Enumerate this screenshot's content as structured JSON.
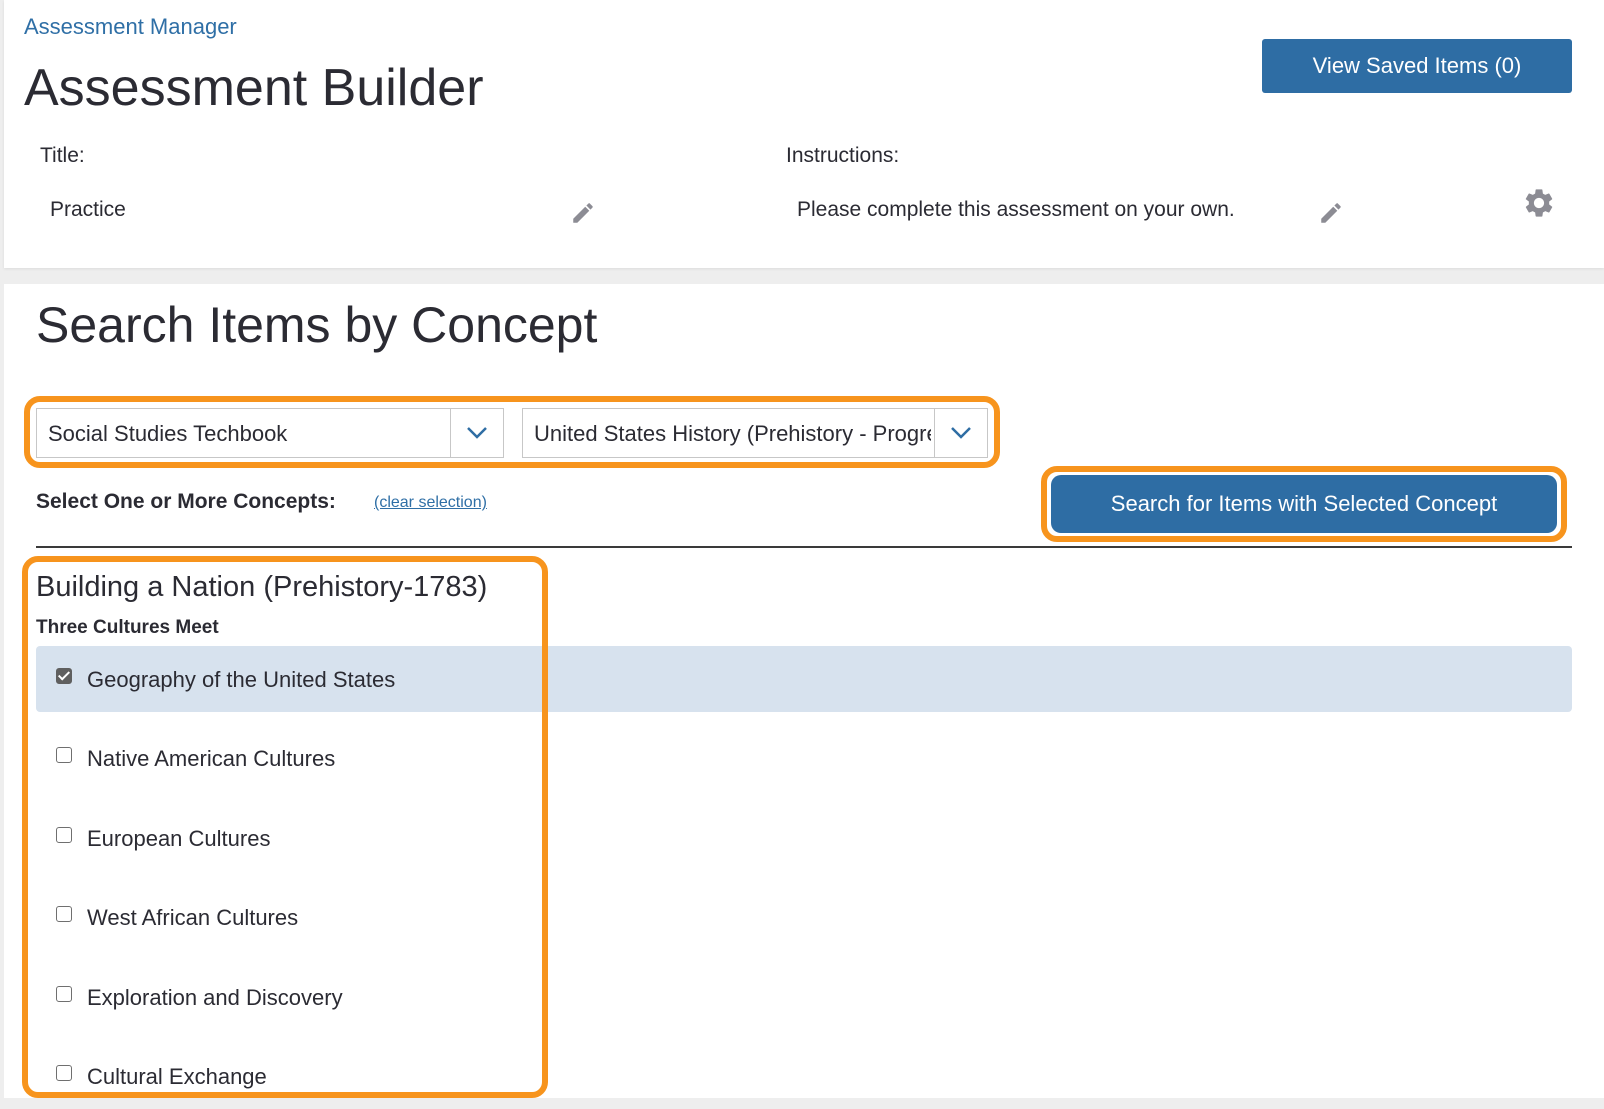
{
  "breadcrumb": "Assessment Manager",
  "page_title": "Assessment Builder",
  "view_saved_button": "View Saved Items (0)",
  "title_field": {
    "label": "Title:",
    "value": "Practice"
  },
  "instructions_field": {
    "label": "Instructions:",
    "value": "Please complete this assessment on your own."
  },
  "search_section": {
    "title": "Search Items by Concept",
    "product_select": "Social Studies Techbook",
    "course_select": "United States History (Prehistory - Progressive Era)",
    "concepts_label": "Select One or More Concepts:",
    "clear_link": "(clear selection)",
    "search_button": "Search for Items with Selected Concept"
  },
  "unit": {
    "title": "Building a Nation (Prehistory-1783)",
    "subunit": "Three Cultures Meet",
    "concepts": [
      {
        "label": "Geography of the United States",
        "checked": true
      },
      {
        "label": "Native American Cultures",
        "checked": false
      },
      {
        "label": "European Cultures",
        "checked": false
      },
      {
        "label": "West African Cultures",
        "checked": false
      },
      {
        "label": "Exploration and Discovery",
        "checked": false
      },
      {
        "label": "Cultural Exchange",
        "checked": false
      }
    ]
  },
  "colors": {
    "primary": "#2e6da4",
    "highlight": "#f7941d",
    "selected_row": "#d7e2ee",
    "link": "#2f6fa6"
  },
  "icons": [
    "pencil-icon",
    "gear-icon",
    "chevron-down-icon",
    "checkbox-icon"
  ]
}
